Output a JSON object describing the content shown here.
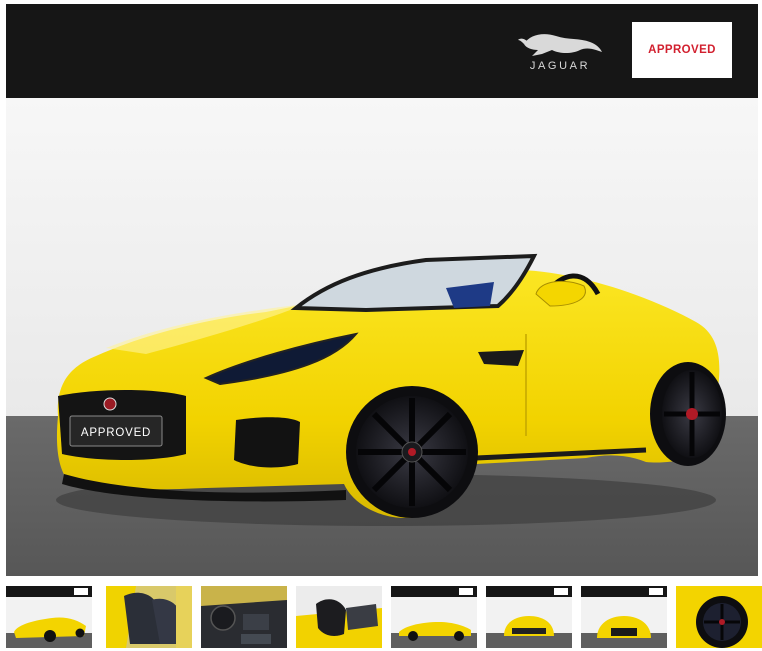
{
  "banner": {
    "brand_wordmark": "JAGUAR",
    "badge_label": "APPROVED"
  },
  "car": {
    "plate_text": "APPROVED",
    "body_color": "#f5d800",
    "wheel_color": "#141418"
  },
  "colors": {
    "banner_bg": "#161616",
    "badge_red": "#d2202f",
    "floor": "#5f5f5f"
  },
  "thumbnails": [
    {
      "view": "front-three-quarter"
    },
    {
      "view": "interior-seats"
    },
    {
      "view": "dashboard"
    },
    {
      "view": "wind-deflector"
    },
    {
      "view": "side-profile"
    },
    {
      "view": "rear"
    },
    {
      "view": "front"
    },
    {
      "view": "wheel-detail"
    }
  ]
}
